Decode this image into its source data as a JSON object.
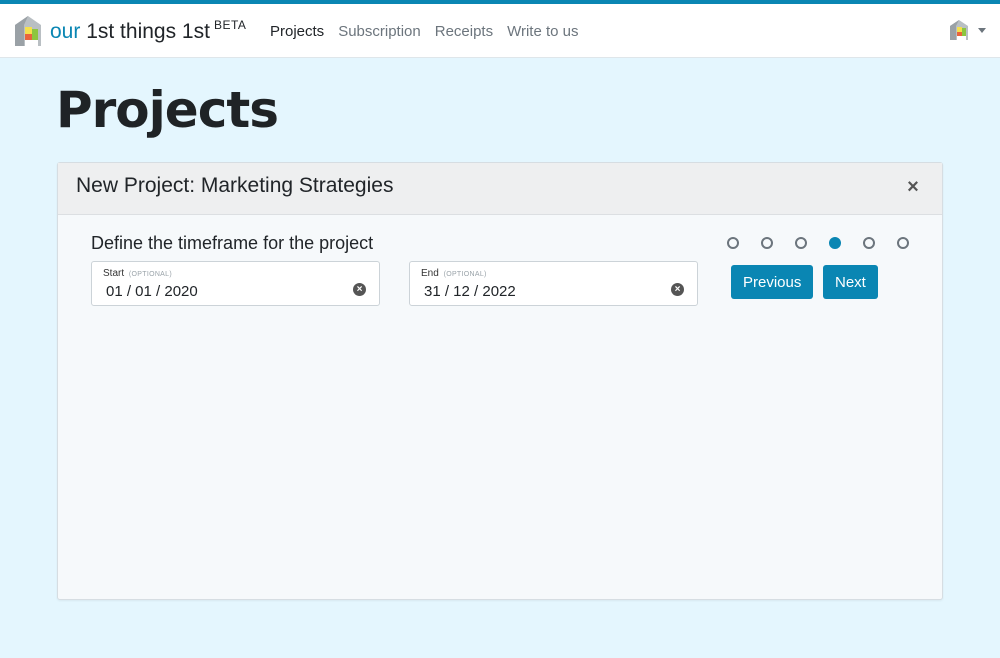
{
  "brand": {
    "our": "our",
    "rest": "1st things 1st",
    "beta": "BETA"
  },
  "nav": {
    "items": [
      {
        "label": "Projects",
        "active": true
      },
      {
        "label": "Subscription",
        "active": false
      },
      {
        "label": "Receipts",
        "active": false
      },
      {
        "label": "Write to us",
        "active": false
      }
    ]
  },
  "page": {
    "title": "Projects"
  },
  "card": {
    "title": "New Project: Marketing Strategies",
    "close_label": "×",
    "step_label": "Define the timeframe for the project",
    "steps": {
      "count": 6,
      "active_index": 3
    },
    "start": {
      "label": "Start",
      "optional": "(OPTIONAL)",
      "value": "01 / 01 / 2020"
    },
    "end": {
      "label": "End",
      "optional": "(OPTIONAL)",
      "value": "31 / 12 / 2022"
    },
    "previous_label": "Previous",
    "next_label": "Next"
  },
  "colors": {
    "accent": "#0a86b3",
    "background": "#e4f6fe"
  },
  "icons": {
    "brand": "house-logo-icon",
    "user": "user-house-icon",
    "clear": "clear-circle-icon"
  }
}
